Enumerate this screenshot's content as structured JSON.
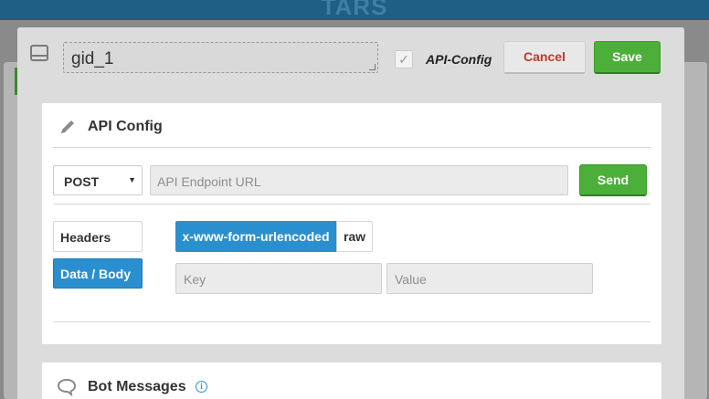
{
  "background": {
    "logo": "TARS"
  },
  "modal": {
    "node_name": "gid_1",
    "api_config_checkbox": {
      "label": "API-Config",
      "checked": true
    },
    "cancel_label": "Cancel",
    "save_label": "Save"
  },
  "api_card": {
    "title": "API Config",
    "method": "POST",
    "url_placeholder": "API Endpoint URL",
    "send_label": "Send",
    "tabs": [
      {
        "label": "Headers",
        "active": false
      },
      {
        "label": "Data / Body",
        "active": true
      }
    ],
    "encodings": [
      {
        "label": "x-www-form-urlencoded",
        "active": true
      },
      {
        "label": "raw",
        "active": false
      }
    ],
    "key_placeholder": "Key",
    "value_placeholder": "Value"
  },
  "bot_card": {
    "title": "Bot Messages",
    "info": "i"
  },
  "colors": {
    "accent_blue": "#2a8fce",
    "save_green": "#4caf3a",
    "cancel_red": "#c0392b"
  }
}
